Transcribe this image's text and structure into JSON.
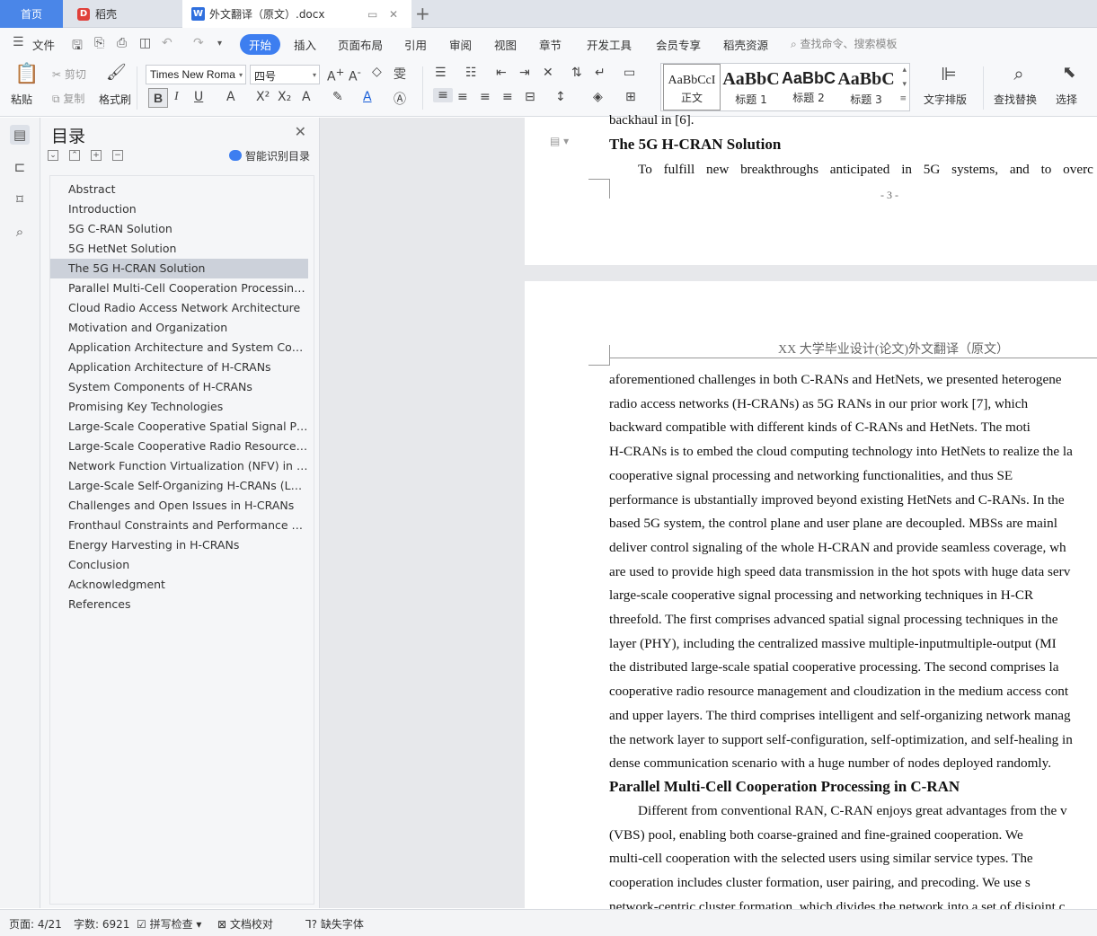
{
  "tabs": {
    "home": "首页",
    "daoke": "稻壳",
    "doc": "外文翻译（原文）.docx"
  },
  "menu": {
    "file": "文件",
    "items": [
      "开始",
      "插入",
      "页面布局",
      "引用",
      "审阅",
      "视图",
      "章节",
      "开发工具",
      "会员专享",
      "稻壳资源"
    ],
    "search": "查找命令、搜索模板"
  },
  "ribbon": {
    "paste": "粘贴",
    "cut": "剪切",
    "copy": "复制",
    "format_painter": "格式刷",
    "font": "Times New Roma",
    "size": "四号",
    "styles": [
      {
        "preview": "AaBbCcI",
        "name": "正文"
      },
      {
        "preview": "AaBbC",
        "name": "标题 1"
      },
      {
        "preview": "AaBbC",
        "name": "标题 2"
      },
      {
        "preview": "AaBbC",
        "name": "标题 3"
      }
    ],
    "text_layout": "文字排版",
    "find_replace": "查找替换",
    "select": "选择"
  },
  "nav": {
    "title": "目录",
    "smart": "智能识别目录",
    "selected_index": 4,
    "items": [
      "Abstract",
      "Introduction",
      "5G C-RAN Solution",
      "5G HetNet Solution",
      "The 5G H-CRAN Solution",
      "Parallel Multi-Cell Cooperation Processing ...",
      "Cloud Radio Access Network Architecture",
      "Motivation and Organization",
      "Application Architecture and System Comp ...",
      "Application Architecture of H-CRANs",
      "System Components of H-CRANs",
      "Promising Key Technologies",
      "Large-Scale Cooperative Spatial Signal Pro ...",
      "Large-Scale Cooperative Radio Resource M ...",
      "Network Function Virtualization (NFV) in H ...",
      "Large-Scale Self-Organizing H-CRANs (LS- ...",
      "Challenges and Open Issues in H-CRANs",
      "Fronthaul Constraints and Performance Op ...",
      "Energy Harvesting in H-CRANs",
      "Conclusion",
      "Acknowledgment",
      "References"
    ]
  },
  "doc": {
    "p1_tail": "backhaul in [6].",
    "p1_heading": "The 5G H-CRAN Solution",
    "p1_line": "To fulfill new breakthroughs anticipated in 5G systems, and to overc",
    "page_number": "- 3 -",
    "header": "XX 大学毕业设计(论文)外文翻译（原文）",
    "lines": [
      "aforementioned challenges in both C-RANs and HetNets, we presented heterogene",
      "radio access networks (H-CRANs) as 5G RANs in our prior work [7], which",
      "backward compatible with different kinds of C-RANs and HetNets. The moti",
      "H-CRANs is to embed the cloud computing technology into HetNets to realize the la",
      "cooperative signal processing and networking functionalities, and thus SE",
      "performance is ubstantially improved beyond existing HetNets and C-RANs. In the",
      "based 5G system, the control plane and user plane are decoupled. MBSs are mainl",
      "deliver control signaling of the whole H-CRAN and provide seamless coverage, wh",
      "are used to provide high speed data transmission in the hot spots with huge data serv",
      "large-scale cooperative signal processing and networking techniques in H-CR",
      "threefold. The first comprises advanced spatial signal processing techniques in the",
      "layer (PHY), including the centralized massive multiple-inputmultiple-output (MI",
      "the distributed large-scale spatial cooperative processing. The second comprises la",
      "cooperative radio resource management and cloudization in the medium access cont",
      "and upper layers. The third comprises intelligent and self-organizing network manag",
      "the network layer to support self-configuration, self-optimization, and self-healing in",
      "dense communication scenario with a huge number of nodes deployed randomly."
    ],
    "heading2": "Parallel Multi-Cell Cooperation Processing in C-RAN",
    "lines2": [
      "Different from conventional RAN, C-RAN enjoys great advantages from the v",
      "(VBS) pool, enabling both coarse-grained and fine-grained cooperation. We",
      "multi-cell cooperation with the selected users using similar service types. The",
      "cooperation includes cluster formation, user pairing, and precoding. We use s",
      "network-centric cluster formation, which divides the network into a set of disjoint c"
    ]
  },
  "status": {
    "page": "页面: 4/21",
    "words": "字数: 6921",
    "spell": "拼写检查",
    "proof": "文档校对",
    "font_missing": "缺失字体"
  }
}
